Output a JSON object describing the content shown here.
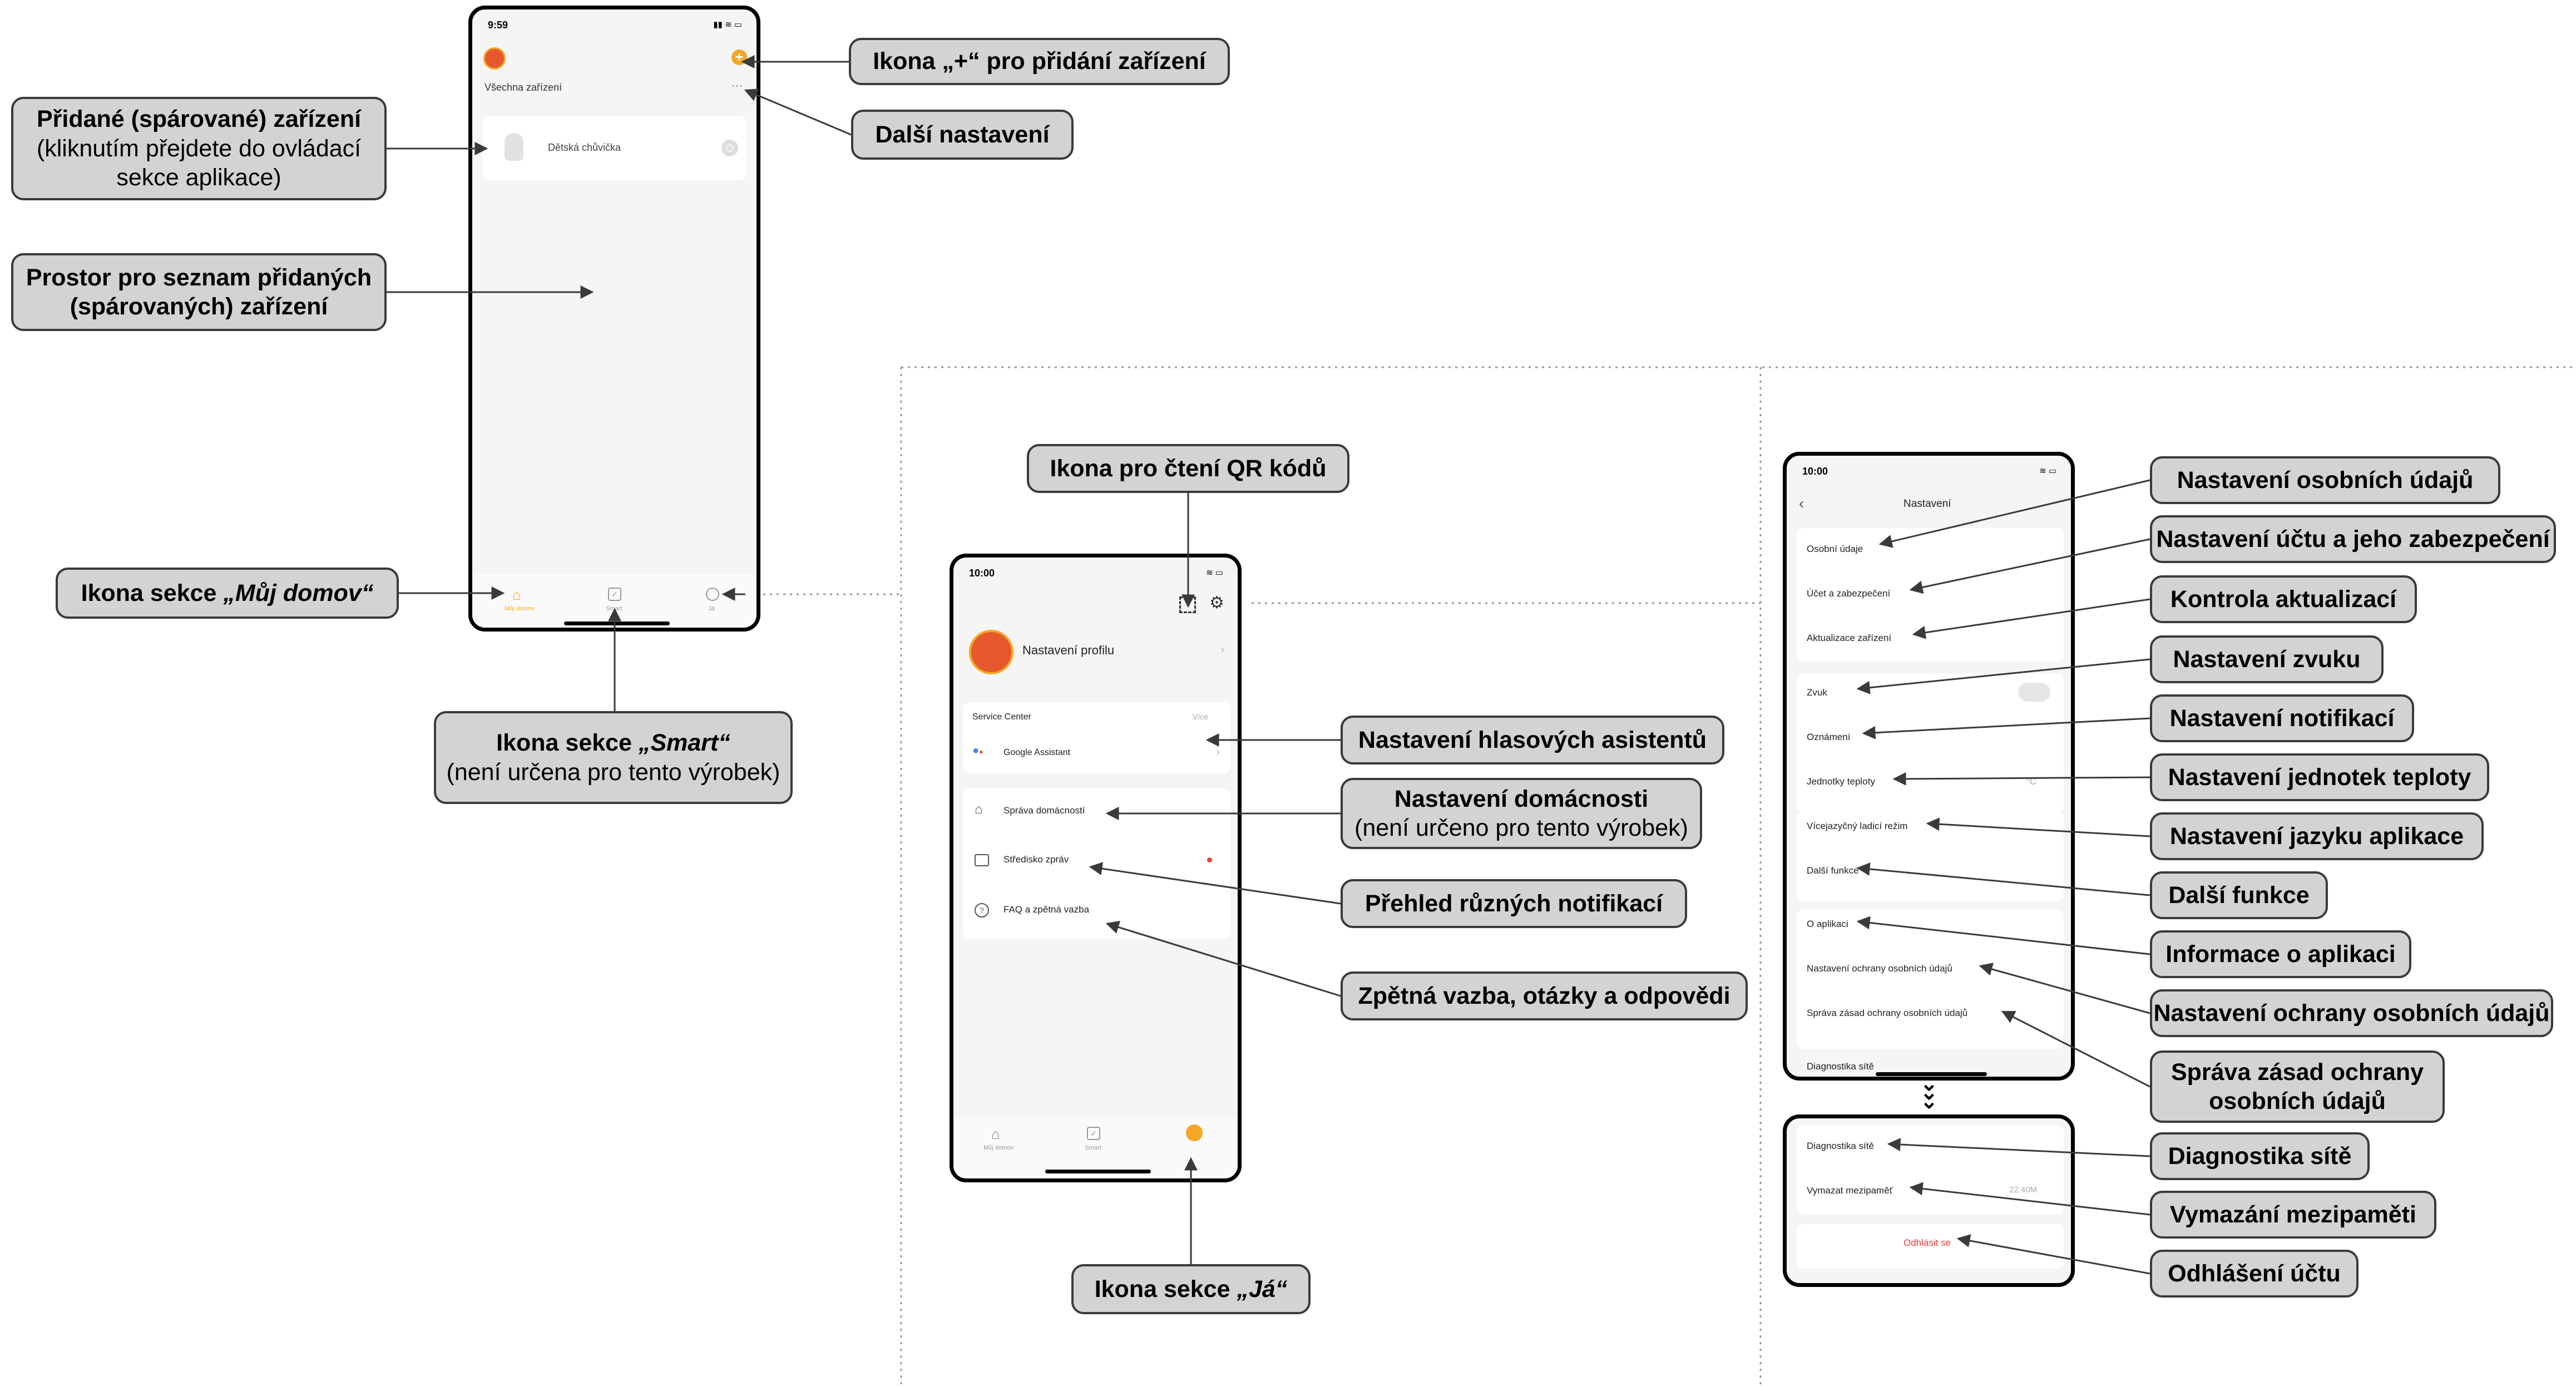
{
  "home": {
    "time": "9:59",
    "title": "Všechna zařízení",
    "more": "···",
    "device_name": "Dětská chůvička",
    "tabs": [
      "Můj domov",
      "Smart",
      "Já"
    ]
  },
  "profile": {
    "time": "10:00",
    "profile_label": "Nastavení profilu",
    "service_center": "Service Center",
    "more_link": "Více",
    "google_assistant": "Google Assistant",
    "items": [
      "Správa domácností",
      "Středisko zpráv",
      "FAQ a zpětná vazba"
    ],
    "tabs": [
      "Můj domov",
      "Smart"
    ]
  },
  "settings": {
    "time": "10:00",
    "title": "Nastavení",
    "items": [
      "Osobní údaje",
      "Účet a zabezpečení",
      "Aktualizace zařízení",
      "Zvuk",
      "Oznámení",
      "Jednotky teploty",
      "Vícejazyčný ladicí režim",
      "Další funkce",
      "O aplikaci",
      "Nastavení ochrany osobních údajů",
      "Správa zásad ochrany osobních údajů",
      "Diagnostika sítě"
    ],
    "temp_value": "°C",
    "items2": [
      "Diagnostika sítě",
      "Vymazat mezipaměť"
    ],
    "cache_size": "22.40M",
    "logout": "Odhlásit se"
  },
  "callouts": {
    "add_device": "Ikona „+“ pro přidání zařízení",
    "more_settings": "Další nastavení",
    "paired_title": "Přidané (spárované) zařízení",
    "paired_sub": "(kliknutím přejdete do ovládací sekce aplikace)",
    "list_space": "Prostor pro seznam přidaných (spárovaných) zařízení",
    "my_home_prefix": "Ikona sekce ",
    "my_home_name": "„Můj domov“",
    "smart_prefix": "Ikona sekce ",
    "smart_name": "„Smart“",
    "smart_sub": "(není určena pro tento výrobek)",
    "qr": "Ikona pro čtení QR kódů",
    "voice": "Nastavení hlasových asistentů",
    "household": "Nastavení domácnosti",
    "household_sub": "(není určeno pro tento výrobek)",
    "notifications_overview": "Přehled různých notifikací",
    "feedback": "Zpětná vazba, otázky a odpovědi",
    "me_prefix": "Ikona sekce ",
    "me_name": "„Já“",
    "personal": "Nastavení osobních údajů",
    "account": "Nastavení účtu a jeho zabezpečení",
    "updates": "Kontrola aktualizací",
    "sound": "Nastavení zvuku",
    "notif": "Nastavení notifikací",
    "temp_units": "Nastavení jednotek teploty",
    "language": "Nastavení jazyku aplikace",
    "more_functions": "Další funkce",
    "about": "Informace o aplikaci",
    "privacy": "Nastavení ochrany osobních údajů",
    "privacy_policy": "Správa zásad ochrany osobních údajů",
    "network": "Diagnostika sítě",
    "clear_cache": "Vymazání mezipaměti",
    "logout": "Odhlášení účtu"
  },
  "colors": {
    "accent": "#f5a623",
    "callout_bg": "#d3d3d3",
    "logout_red": "#e8413b"
  }
}
